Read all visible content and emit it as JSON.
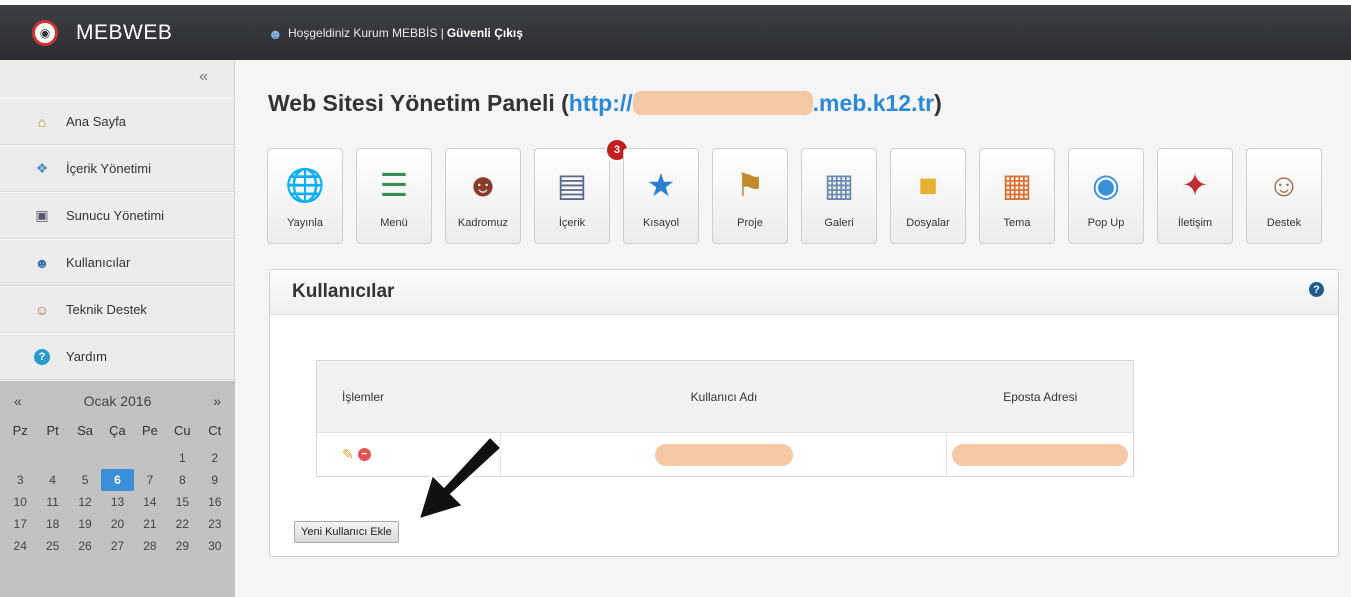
{
  "header": {
    "brand": "MEBWEB",
    "welcome": "Hoşgeldiniz Kurum MEBBİS |",
    "logout": "Güvenli Çıkış"
  },
  "sidebar": {
    "collapse_glyph": "«",
    "items": [
      {
        "label": "Ana Sayfa",
        "icon": "home-icon"
      },
      {
        "label": "İçerik Yönetimi",
        "icon": "content-icon"
      },
      {
        "label": "Sunucu Yönetimi",
        "icon": "server-icon"
      },
      {
        "label": "Kullanıcılar",
        "icon": "users-icon"
      },
      {
        "label": "Teknik Destek",
        "icon": "support-icon"
      },
      {
        "label": "Yardım",
        "icon": "help-icon"
      }
    ]
  },
  "calendar": {
    "prev": "«",
    "next": "»",
    "month": "Ocak 2016",
    "day_names": [
      "Pz",
      "Pt",
      "Sa",
      "Ça",
      "Pe",
      "Cu",
      "Ct"
    ],
    "today": "6",
    "days": [
      "",
      "",
      "",
      "",
      "",
      "1",
      "2",
      "3",
      "4",
      "5",
      "6",
      "7",
      "8",
      "9",
      "10",
      "11",
      "12",
      "13",
      "14",
      "15",
      "16",
      "17",
      "18",
      "19",
      "20",
      "21",
      "22",
      "23",
      "24",
      "25",
      "26",
      "27",
      "28",
      "29",
      "30"
    ]
  },
  "main": {
    "title_prefix": "Web Sitesi Yönetim Paneli (",
    "url_start": "http://",
    "url_end": ".meb.k12.tr",
    "title_suffix": ")"
  },
  "toolbar": {
    "badge": "3",
    "items": [
      {
        "label": "Yayınla",
        "icon": "globe-icon"
      },
      {
        "label": "Menü",
        "icon": "menu-tree-icon"
      },
      {
        "label": "Kadromuz",
        "icon": "staff-icon"
      },
      {
        "label": "İçerik",
        "icon": "article-icon"
      },
      {
        "label": "Kısayol",
        "icon": "star-icon"
      },
      {
        "label": "Proje",
        "icon": "project-icon"
      },
      {
        "label": "Galeri",
        "icon": "gallery-icon"
      },
      {
        "label": "Dosyalar",
        "icon": "folder-icon"
      },
      {
        "label": "Tema",
        "icon": "theme-icon"
      },
      {
        "label": "Pop Up",
        "icon": "popup-icon"
      },
      {
        "label": "İletişim",
        "icon": "map-pin-icon"
      },
      {
        "label": "Destek",
        "icon": "headset-icon"
      }
    ]
  },
  "panel": {
    "title": "Kullanıcılar",
    "help": "?",
    "table": {
      "headers": [
        "İşlemler",
        "Kullanıcı Adı",
        "Eposta Adresi"
      ]
    },
    "add_button": "Yeni Kullanıcı Ekle"
  },
  "colors": {
    "accent": "#2a88d8",
    "redacted": "#f5c9a6",
    "badge": "#c41f1f"
  }
}
